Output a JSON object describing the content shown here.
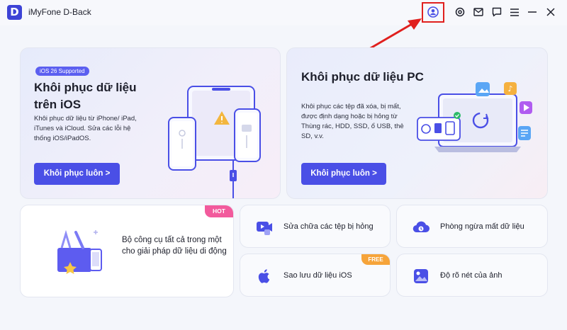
{
  "app": {
    "logo_letter": "D",
    "title": "iMyFone D-Back"
  },
  "titlebar_icons": [
    "account-icon",
    "settings-icon",
    "mail-icon",
    "feedback-icon",
    "menu-icon",
    "minimize-icon",
    "close-icon"
  ],
  "ios_card": {
    "badge": "iOS 26 Supported",
    "title": "Khôi phục dữ liệu trên iOS",
    "description": "Khôi phục dữ liệu từ iPhone/ iPad, iTunes và iCloud. Sửa các lỗi hệ thống iOS/iPadOS.",
    "button": "Khôi phục luôn >"
  },
  "pc_card": {
    "title": "Khôi phục dữ liệu PC",
    "description": "Khôi phục các tệp đã xóa, bị mất, được định dạng hoặc bị hỏng từ Thùng rác, HDD, SSD, ổ USB, thẻ SD, v.v.",
    "button": "Khôi phục luôn >"
  },
  "tool_card": {
    "tag": "HOT",
    "text": "Bộ công cụ tất cả trong một cho giải pháp dữ liệu di động"
  },
  "small_cards": {
    "repair": {
      "label": "Sửa chữa các tệp bị hỏng"
    },
    "prevent": {
      "label": "Phòng ngừa mất dữ liệu"
    },
    "backup": {
      "label": "Sao lưu dữ liệu iOS",
      "tag": "FREE"
    },
    "enhance": {
      "label": "Độ rõ nét của ảnh"
    }
  },
  "colors": {
    "accent": "#4a4fe6",
    "hot": "#f25a9c",
    "free": "#f6a43a",
    "annotation": "#e0201e"
  }
}
